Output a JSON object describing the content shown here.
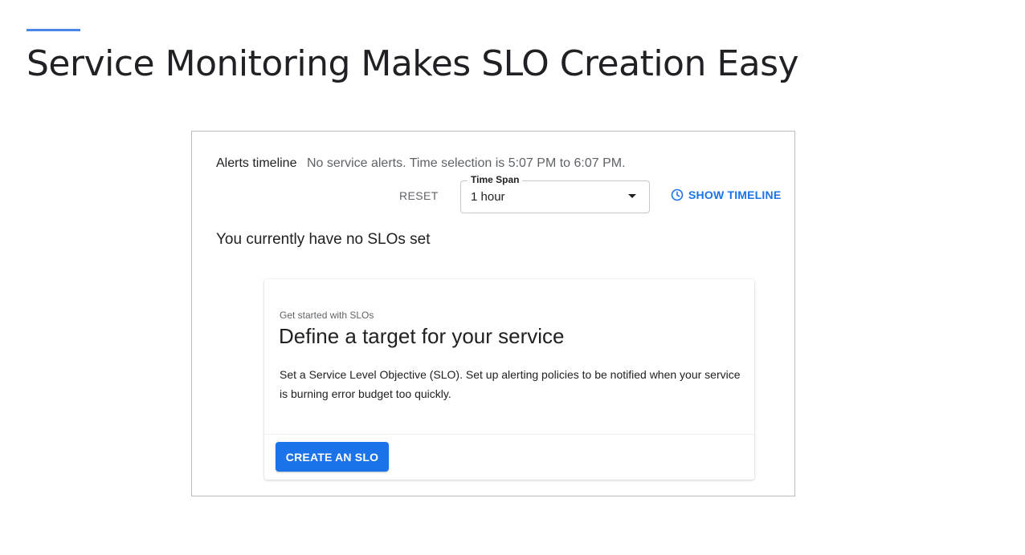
{
  "slide": {
    "title": "Service Monitoring Makes SLO Creation Easy"
  },
  "alerts": {
    "label": "Alerts timeline",
    "message": "No service alerts. Time selection is 5:07 PM to 6:07 PM."
  },
  "controls": {
    "reset_label": "RESET",
    "timespan_label": "Time Span",
    "timespan_value": "1 hour",
    "show_timeline_label": "SHOW TIMELINE"
  },
  "status": {
    "no_slos": "You currently have no SLOs set"
  },
  "card": {
    "eyebrow": "Get started with SLOs",
    "title": "Define a target for your service",
    "body": "Set a Service Level Objective (SLO). Set up alerting policies to be notified when your service is burning error budget too quickly.",
    "cta_label": "CREATE AN SLO"
  },
  "colors": {
    "accent": "#1a73e8",
    "rule": "#4a86e8"
  },
  "icons": {
    "timeline": "clock-icon",
    "dropdown": "dropdown-arrow-icon"
  }
}
